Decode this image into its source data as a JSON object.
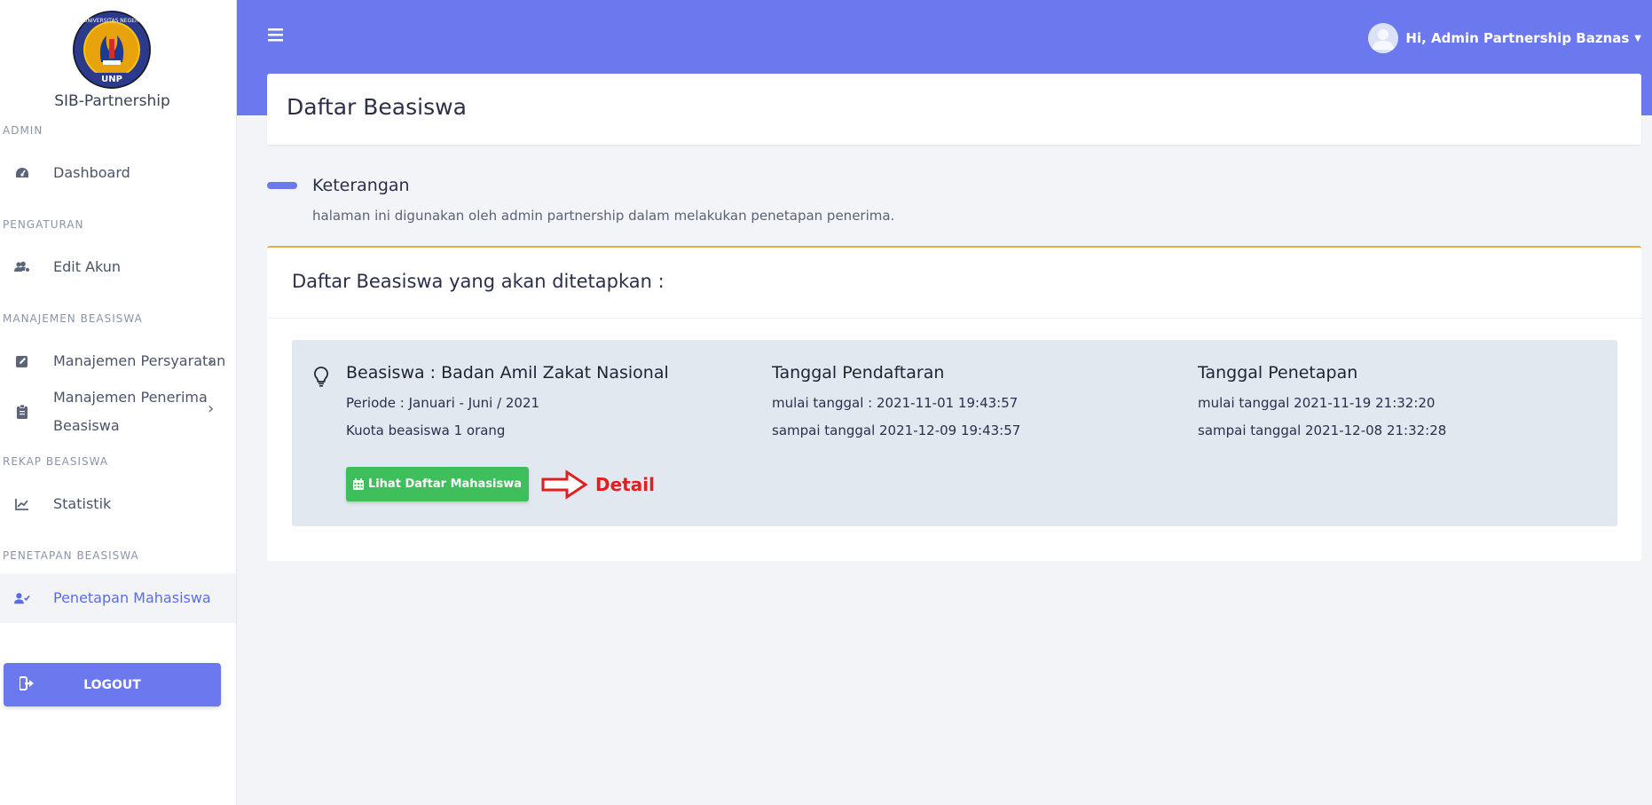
{
  "sidebar": {
    "brand": "SIB-Partnership",
    "sections": {
      "admin": "ADMIN",
      "pengaturan": "PENGATURAN",
      "manajemen": "MANAJEMEN BEASISWA",
      "rekap": "REKAP BEASISWA",
      "penetapan": "PENETAPAN BEASISWA"
    },
    "items": {
      "dashboard": "Dashboard",
      "edit_akun": "Edit Akun",
      "persyaratan": "Manajemen Persyaratan",
      "penerima_line1": "Manajemen Penerima",
      "penerima_line2": "Beasiswa",
      "statistik": "Statistik",
      "penetapan_mhs": "Penetapan Mahasiswa"
    },
    "logout": "LOGOUT"
  },
  "topbar": {
    "user_greeting": "Hi, Admin Partnership Baznas"
  },
  "page": {
    "title": "Daftar Beasiswa",
    "keterangan_title": "Keterangan",
    "keterangan_desc": "halaman ini digunakan oleh admin partnership dalam melakukan penetapan penerima.",
    "card_title": "Daftar Beasiswa yang akan ditetapkan :"
  },
  "beasiswa": {
    "name": "Beasiswa : Badan Amil Zakat Nasional",
    "periode": "Periode : Januari - Juni / 2021",
    "kuota": "Kuota beasiswa 1 orang",
    "pendaftaran_title": "Tanggal Pendaftaran",
    "pendaftaran_mulai": "mulai tanggal : 2021-11-01 19:43:57",
    "pendaftaran_sampai": "sampai tanggal 2021-12-09 19:43:57",
    "penetapan_title": "Tanggal Penetapan",
    "penetapan_mulai": "mulai tanggal 2021-11-19 21:32:20",
    "penetapan_sampai": "sampai tanggal 2021-12-08 21:32:28",
    "button_label": "Lihat Daftar Mahasiswa",
    "annotation": "Detail"
  },
  "colors": {
    "accent": "#6b78ee",
    "success": "#3fbf5c",
    "warning_border": "#f2a93b",
    "annotation": "#e02020"
  },
  "logo_text": {
    "top": "UNIVERSITAS NEGERI PADANG",
    "bottom": "UNP"
  }
}
